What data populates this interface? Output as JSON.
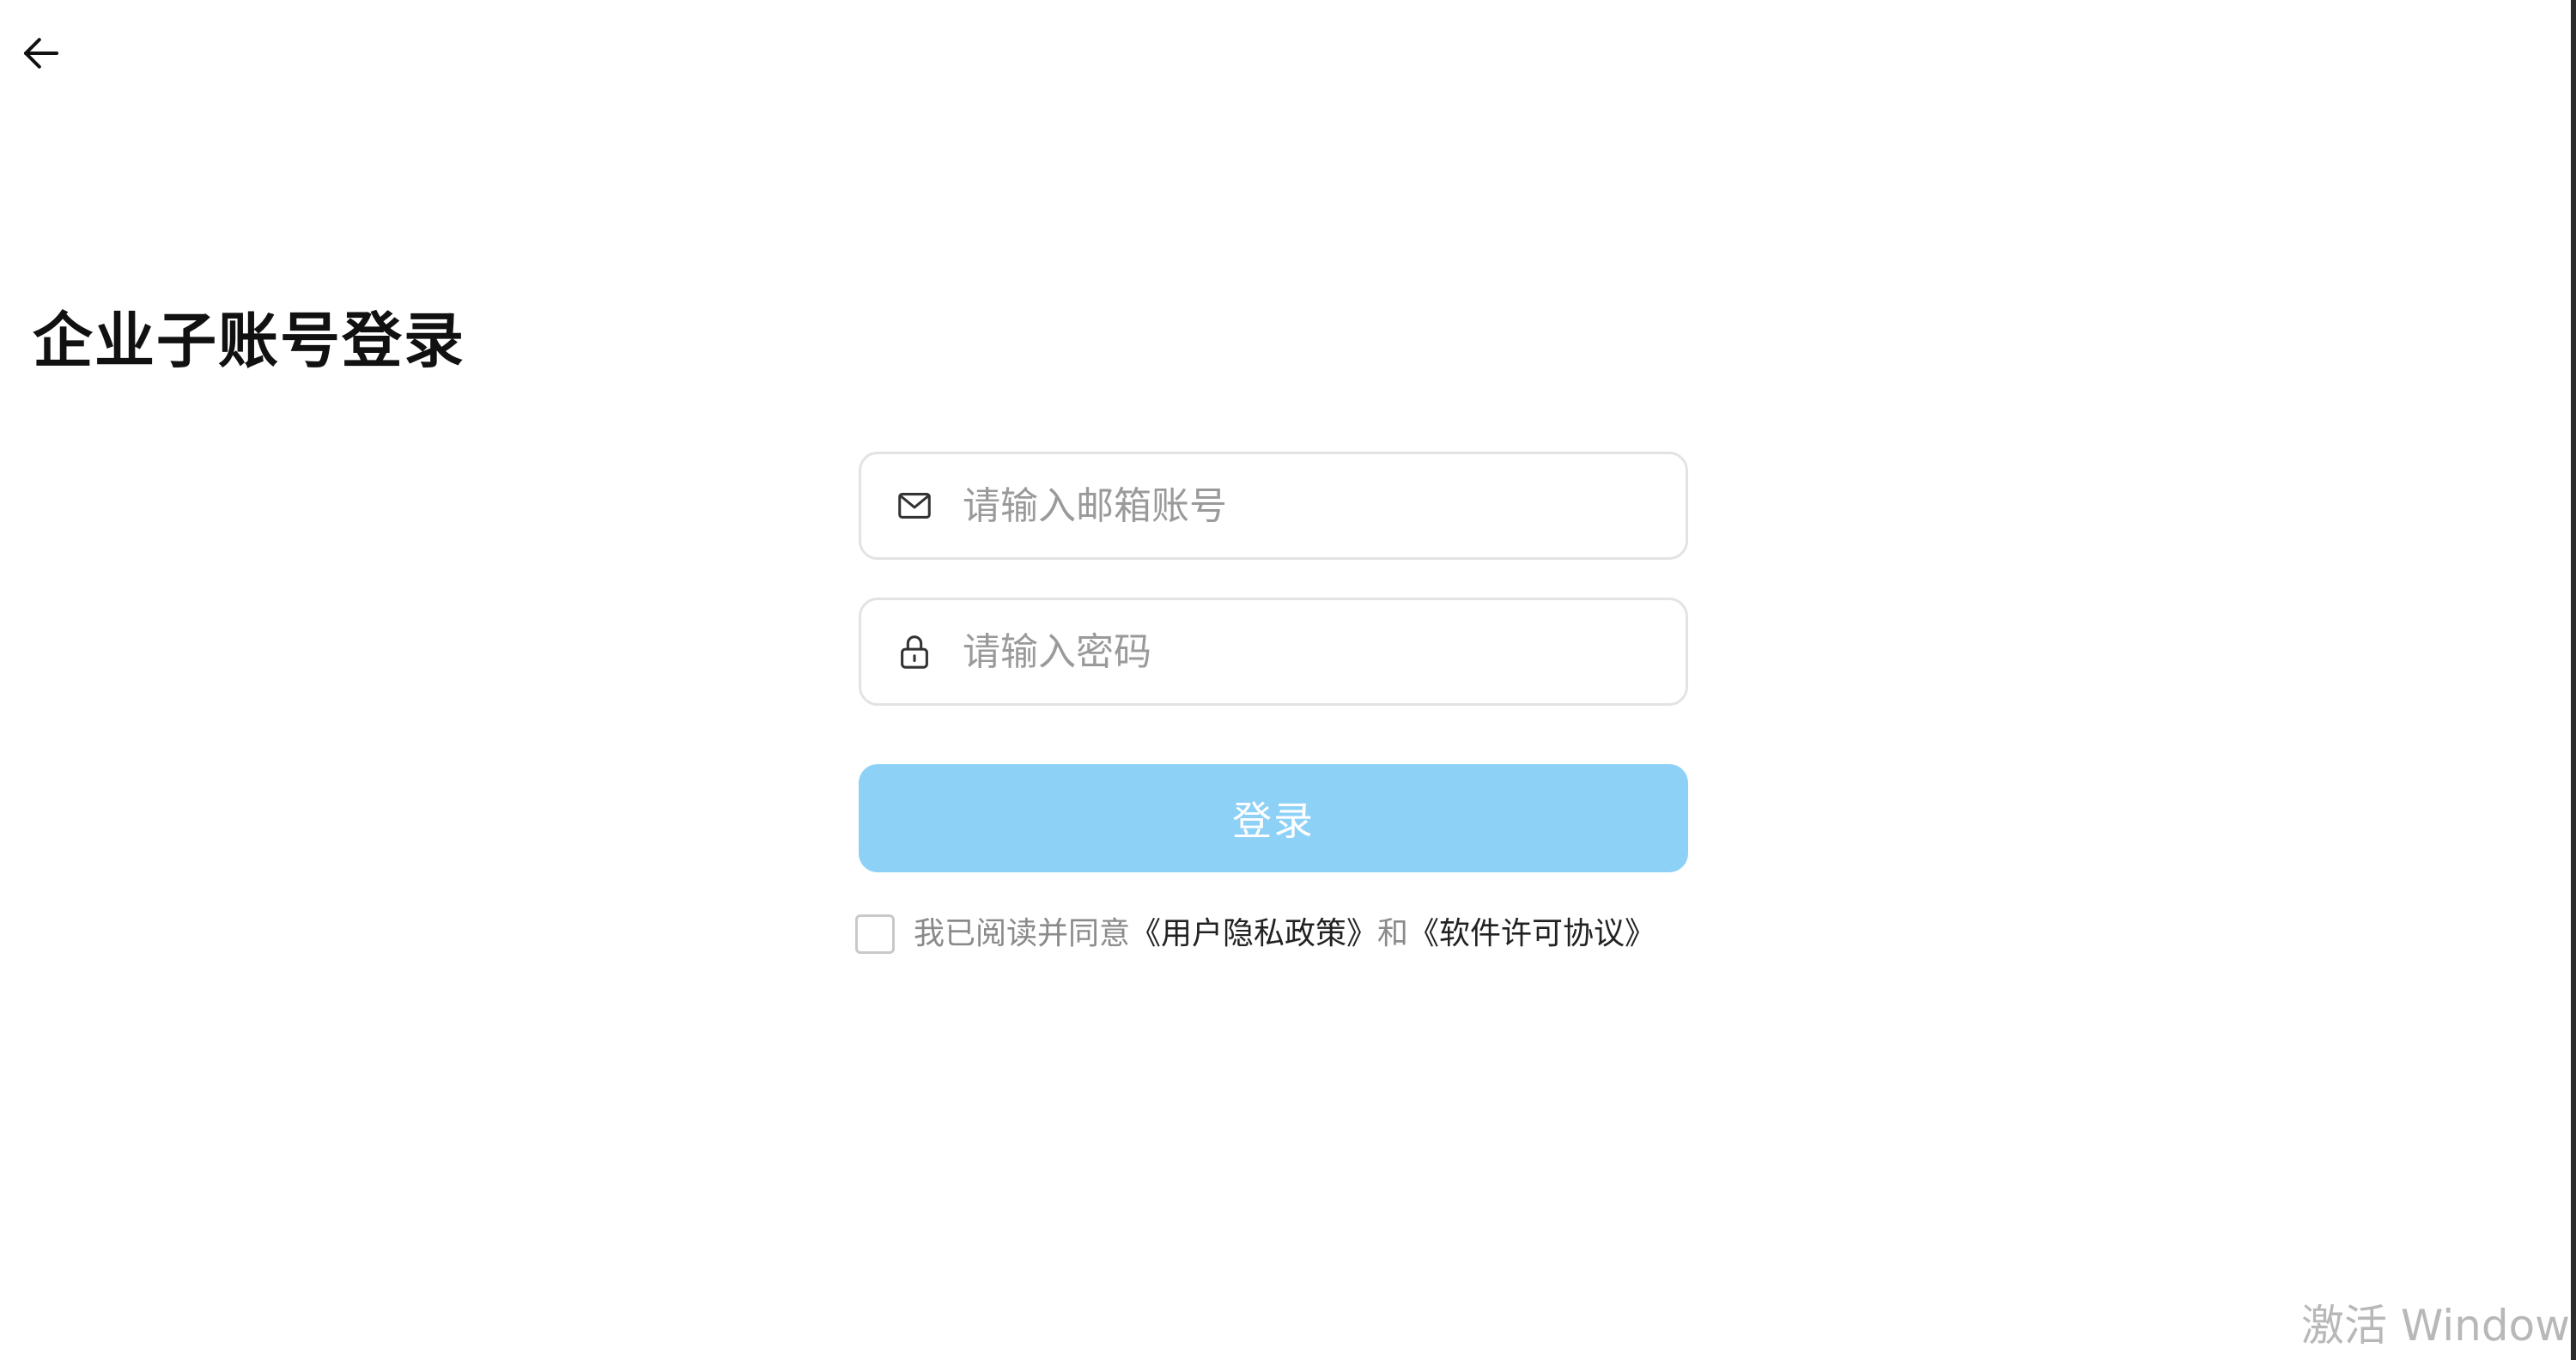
{
  "header": {
    "back_icon": "arrow-left-icon",
    "title": "企业子账号登录"
  },
  "form": {
    "email": {
      "icon": "mail-icon",
      "placeholder": "请输入邮箱账号",
      "value": ""
    },
    "password": {
      "icon": "lock-icon",
      "placeholder": "请输入密码",
      "value": ""
    },
    "login_label": "登录"
  },
  "agreement": {
    "checked": false,
    "prefix": "我已阅读并同意",
    "privacy_link": "《用户隐私政策》",
    "conjunction": "和",
    "license_link": "《软件许可协议》"
  },
  "watermark": {
    "text": "激活 Windows"
  },
  "colors": {
    "button_bg": "#8dd1f7",
    "button_text": "#ffffff",
    "border": "#e3e3e3",
    "placeholder": "#9a9a9a",
    "title": "#111111"
  }
}
